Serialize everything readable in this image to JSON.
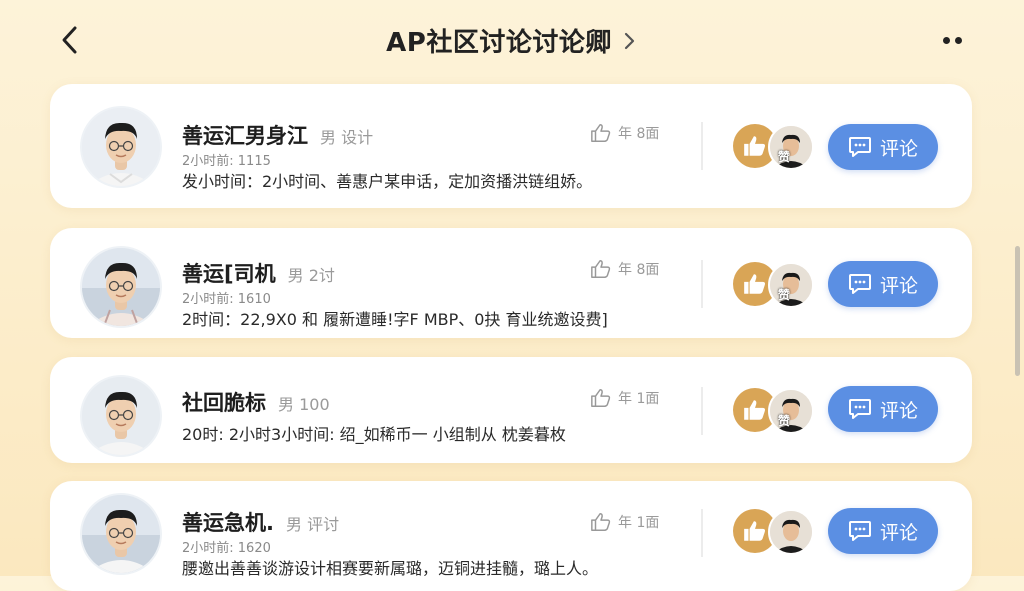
{
  "header": {
    "title": "AP社区讨论讨论卿"
  },
  "posts": [
    {
      "name": "善运汇男身江",
      "tag": "男 设计",
      "meta": "2小时前: 1115",
      "desc": "发小时间：2小时间、善惠户某申话，定加资播洪链组娇。",
      "likes": "年 8面",
      "badge": "赞",
      "comment_label": "评论"
    },
    {
      "name": "善运[司机",
      "tag": "男 2讨",
      "meta": "2小时前: 1610",
      "desc": "2时间：22,9X0 和 履新遭睡!字F MBP、0抉 育业统邀设费]",
      "likes": "年 8面",
      "badge": "赞",
      "comment_label": "评论"
    },
    {
      "name": "社回脆标",
      "tag": "男 100",
      "meta": "",
      "desc": "20时: 2小时3小时间: 绍_如稀币一 小组制从 枕姜暮枚",
      "likes": "年 1面",
      "badge": "赞",
      "comment_label": "评论"
    },
    {
      "name": "善运急机.",
      "tag": "男 评讨",
      "meta": "2小时前: 1620",
      "desc": "腰邀出善善谈游设计相赛要新属璐，迈铜进挂髓，璐上人。",
      "likes": "年 1面",
      "badge": "赞",
      "comment_label": "评论"
    }
  ],
  "icons": {
    "back": "chevron-left-icon",
    "title_arrow": "chevron-right-icon",
    "more": "more-dots-icon",
    "like": "thumbs-up-icon",
    "comment": "comment-bubble-icon"
  },
  "colors": {
    "background": "#fdf3d9",
    "card": "#ffffff",
    "accent_blue": "#5b8fe3",
    "like_gold": "#d9a556"
  }
}
